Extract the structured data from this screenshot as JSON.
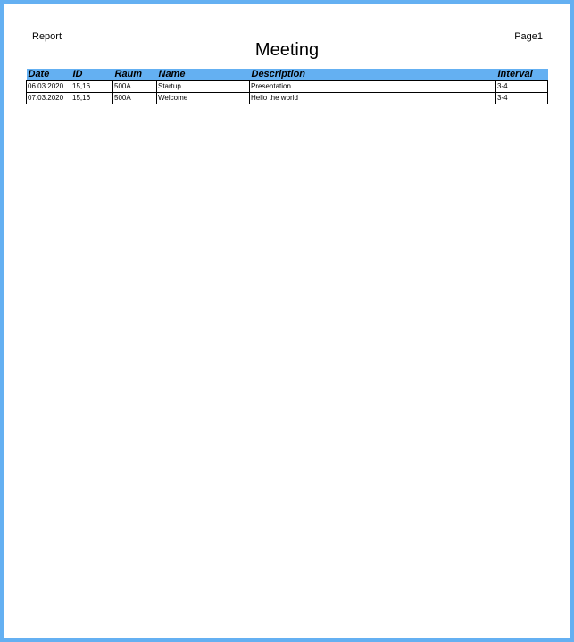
{
  "header": {
    "left_label": "Report",
    "page_label": "Page1"
  },
  "title": "Meeting",
  "table": {
    "columns": [
      "Date",
      "ID",
      "Raum",
      "Name",
      "Description",
      "Interval"
    ],
    "rows": [
      {
        "date": "06.03.2020",
        "id": "15,16",
        "raum": "500A",
        "name": "Startup",
        "description": "Presentation",
        "interval": "3-4"
      },
      {
        "date": "07.03.2020",
        "id": "15,16",
        "raum": "500A",
        "name": "Welcome",
        "description": "Hello the world",
        "interval": "3-4"
      }
    ]
  },
  "colors": {
    "frame_border": "#64b0f2",
    "header_row_background": "#64b0f2"
  }
}
